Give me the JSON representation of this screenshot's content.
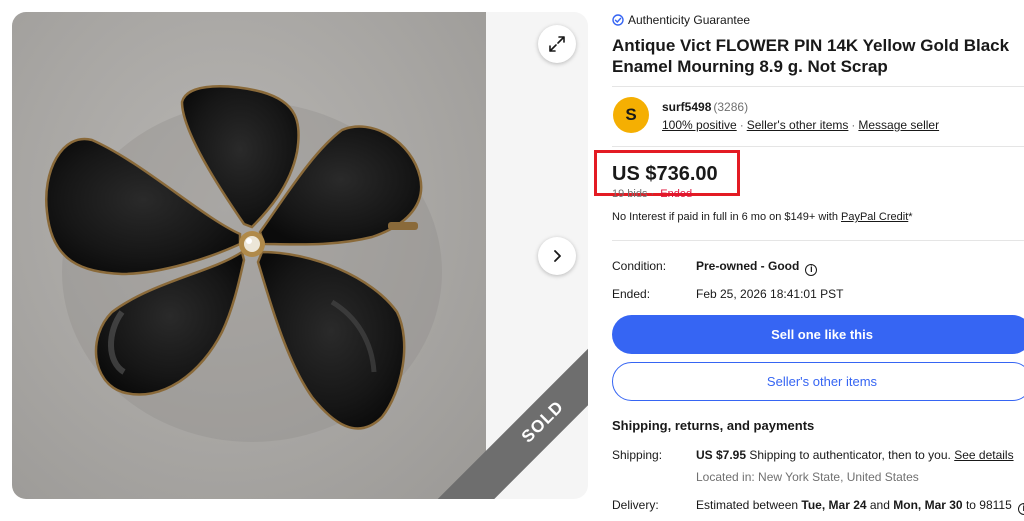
{
  "gallery": {
    "sold_label": "SOLD"
  },
  "listing": {
    "authenticity": "Authenticity Guarantee",
    "title_line1": "Antique Vict FLOWER PIN 14K Yellow Gold Black",
    "title_line2": "Enamel Mourning 8.9 g. Not Scrap"
  },
  "seller": {
    "initial": "S",
    "name": "surf5498",
    "feedback_count": "(3286)",
    "positive": "100% positive",
    "other_items": "Seller's other items",
    "message": "Message seller"
  },
  "price": {
    "amount": "US $736.00",
    "bids": "19 bids",
    "status": "Ended",
    "credit_text": "No Interest if paid in full in 6 mo on $149+ with ",
    "credit_link": "PayPal Credit",
    "credit_suffix": "*"
  },
  "details": {
    "condition_label": "Condition:",
    "condition_value": "Pre-owned - Good",
    "ended_label": "Ended:",
    "ended_value": "Feb 25, 2026 18:41:01 PST"
  },
  "actions": {
    "sell_one": "Sell one like this",
    "sellers_other": "Seller's other items"
  },
  "shipping": {
    "section_title": "Shipping, returns, and payments",
    "shipping_label": "Shipping:",
    "shipping_price": "US $7.95",
    "shipping_text": " Shipping to authenticator, then to you. ",
    "see_details": "See details",
    "location": "Located in: New York State, United States",
    "delivery_label": "Delivery:",
    "delivery_pre": "Estimated between ",
    "delivery_start": "Tue, Mar 24",
    "delivery_mid": " and ",
    "delivery_end": "Mon, Mar 30",
    "delivery_post": " to 98115"
  },
  "colors": {
    "accent": "#3665f3",
    "price_highlight": "#e31b23",
    "avatar": "#f5af02",
    "ended": "#e0103a"
  }
}
